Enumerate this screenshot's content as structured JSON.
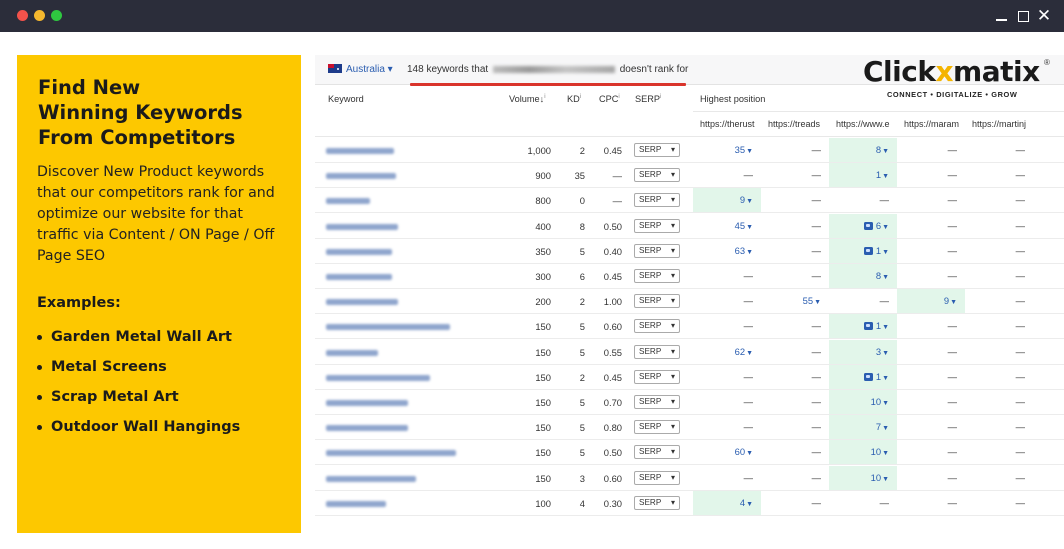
{
  "panel": {
    "title_lines": [
      "Find New",
      "Winning Keywords",
      "From Competitors"
    ],
    "description": "Discover New Product keywords that our competitors rank for and optimize our website for that traffic via Content / ON Page / Off Page SEO",
    "examples_title": "Examples:",
    "examples": [
      "Garden Metal Wall Art",
      "Metal Screens",
      "Scrap Metal Art",
      "Outdoor Wall Hangings"
    ]
  },
  "filter": {
    "country": "Australia ▾",
    "count_prefix": "148 keywords that",
    "count_suffix": "doesn't rank for"
  },
  "logo": {
    "name_left": "Click",
    "name_x": "x",
    "name_right": "matix",
    "reg": "®",
    "tagline": "CONNECT • DIGITALIZE • GROW"
  },
  "table": {
    "headers": {
      "keyword": "Keyword",
      "volume": "Volume↓",
      "kd": "KD",
      "cpc": "CPC",
      "serp": "SERP",
      "highest_position": "Highest position"
    },
    "urls": [
      "https://therust",
      "https://treads",
      "https://www.e",
      "https://maram",
      "https://martinj"
    ],
    "rows": [
      {
        "volume": "1,000",
        "kd": "2",
        "cpc": "0.45",
        "serp": "SERP",
        "pos": [
          "35",
          "—",
          "8",
          "—",
          "—"
        ]
      },
      {
        "volume": "900",
        "kd": "35",
        "cpc": "—",
        "serp": "SERP",
        "pos": [
          "—",
          "—",
          "1",
          "—",
          "—"
        ]
      },
      {
        "volume": "800",
        "kd": "0",
        "cpc": "—",
        "serp": "SERP",
        "pos": [
          "9",
          "—",
          "—",
          "—",
          "—"
        ]
      },
      {
        "volume": "400",
        "kd": "8",
        "cpc": "0.50",
        "serp": "SERP",
        "pos": [
          "45",
          "—",
          "6",
          "—",
          "—"
        ]
      },
      {
        "volume": "350",
        "kd": "5",
        "cpc": "0.40",
        "serp": "SERP",
        "pos": [
          "63",
          "—",
          "1",
          "—",
          "—"
        ]
      },
      {
        "volume": "300",
        "kd": "6",
        "cpc": "0.45",
        "serp": "SERP",
        "pos": [
          "—",
          "—",
          "8",
          "—",
          "—"
        ]
      },
      {
        "volume": "200",
        "kd": "2",
        "cpc": "1.00",
        "serp": "SERP",
        "pos": [
          "—",
          "55",
          "—",
          "9",
          "—"
        ]
      },
      {
        "volume": "150",
        "kd": "5",
        "cpc": "0.60",
        "serp": "SERP",
        "pos": [
          "—",
          "—",
          "1",
          "—",
          "—"
        ]
      },
      {
        "volume": "150",
        "kd": "5",
        "cpc": "0.55",
        "serp": "SERP",
        "pos": [
          "62",
          "—",
          "3",
          "—",
          "—"
        ]
      },
      {
        "volume": "150",
        "kd": "2",
        "cpc": "0.45",
        "serp": "SERP",
        "pos": [
          "—",
          "—",
          "1",
          "—",
          "—"
        ]
      },
      {
        "volume": "150",
        "kd": "5",
        "cpc": "0.70",
        "serp": "SERP",
        "pos": [
          "—",
          "—",
          "10",
          "—",
          "—"
        ]
      },
      {
        "volume": "150",
        "kd": "5",
        "cpc": "0.80",
        "serp": "SERP",
        "pos": [
          "—",
          "—",
          "7",
          "—",
          "—"
        ]
      },
      {
        "volume": "150",
        "kd": "5",
        "cpc": "0.50",
        "serp": "SERP",
        "pos": [
          "60",
          "—",
          "10",
          "—",
          "—"
        ]
      },
      {
        "volume": "150",
        "kd": "3",
        "cpc": "0.60",
        "serp": "SERP",
        "pos": [
          "—",
          "—",
          "10",
          "—",
          "—"
        ]
      },
      {
        "volume": "100",
        "kd": "4",
        "cpc": "0.30",
        "serp": "SERP",
        "pos": [
          "4",
          "—",
          "—",
          "—",
          "—"
        ]
      }
    ]
  }
}
